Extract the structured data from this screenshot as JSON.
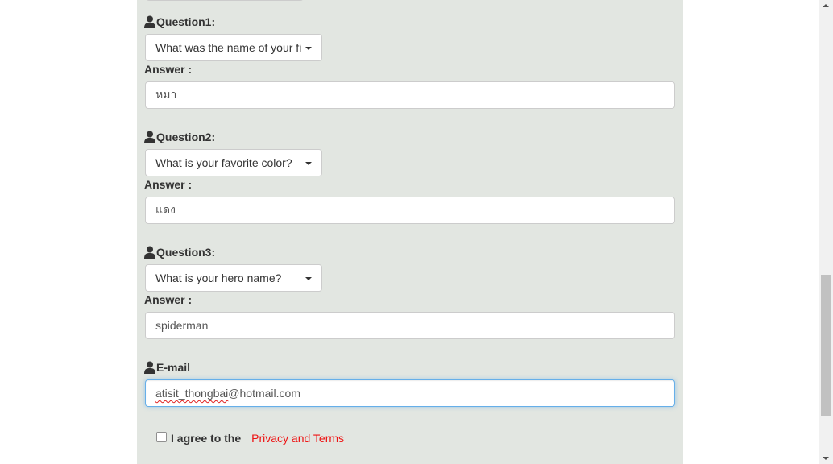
{
  "form": {
    "questions": [
      {
        "label": "Question1:",
        "selected": "What was the name of your first pet?",
        "answer_label": "Answer :",
        "answer": "หมา"
      },
      {
        "label": "Question2:",
        "selected": "What is your favorite color?",
        "answer_label": "Answer :",
        "answer": "แดง"
      },
      {
        "label": "Question3:",
        "selected": "What is your hero name?",
        "answer_label": "Answer :",
        "answer": "spiderman"
      }
    ],
    "email": {
      "label": "E-mail",
      "value_underlined": "atisit_thongbai",
      "value_rest": "@hotmail.com"
    },
    "agree": {
      "text": "I agree to the",
      "link": "Privacy and Terms",
      "checked": false
    }
  },
  "icons": {
    "question": "user-icon",
    "email": "user-icon"
  },
  "colors": {
    "panel_bg": "#e2e6e1",
    "link": "#ee1111",
    "focus_border": "#66afe9"
  }
}
